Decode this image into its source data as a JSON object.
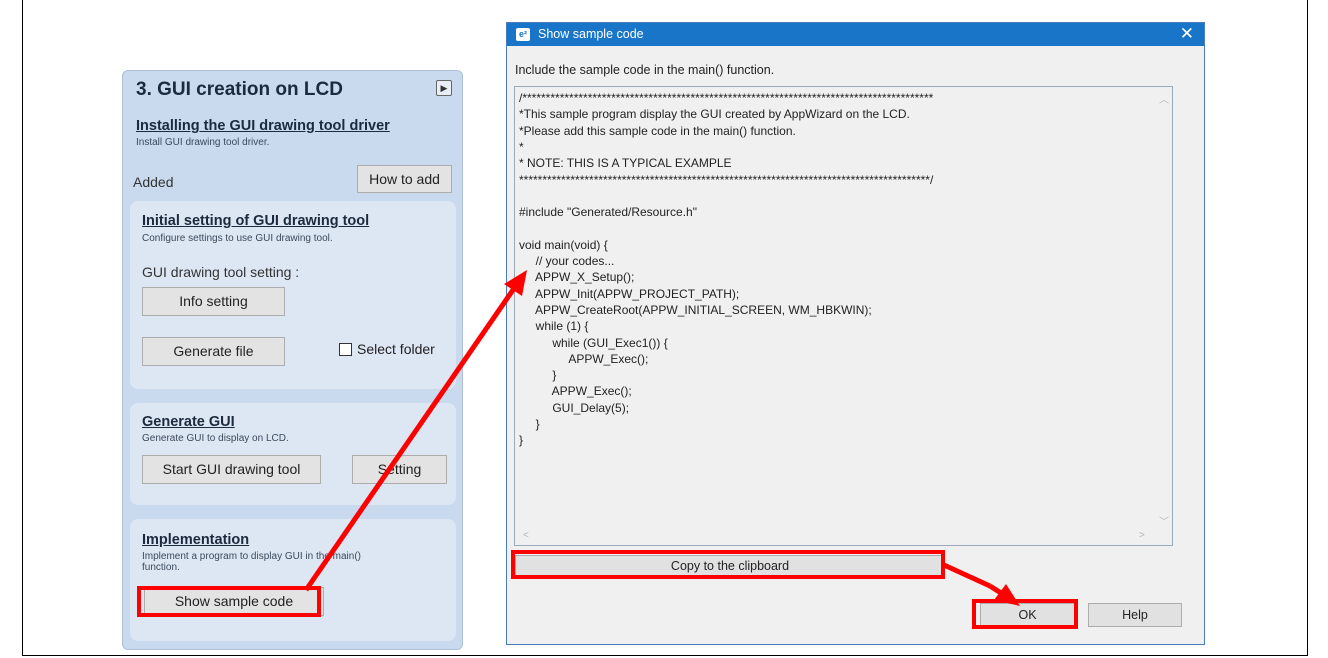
{
  "left_panel": {
    "title": "3. GUI creation on LCD",
    "driver_section": {
      "title": "Installing the GUI drawing tool driver",
      "desc": "Install GUI drawing tool driver.",
      "status": "Added",
      "how_to_add_label": "How to add"
    },
    "initial_section": {
      "title": "Initial setting of GUI drawing tool",
      "desc": "Configure settings to use GUI drawing tool.",
      "setting_label": "GUI drawing tool setting :",
      "info_setting_label": "Info setting",
      "generate_file_label": "Generate file",
      "select_folder_label": "Select folder"
    },
    "generate_section": {
      "title": "Generate GUI",
      "desc": "Generate GUI to display on LCD.",
      "start_tool_label": "Start GUI drawing tool",
      "setting_label": "Setting"
    },
    "implementation_section": {
      "title": "Implementation",
      "desc_line1": "Implement a program to display GUI in the main()",
      "desc_line2": "function.",
      "show_sample_label": "Show sample code"
    }
  },
  "dialog": {
    "title": "Show sample code",
    "app_icon_text": "e²",
    "instruction": "Include the sample code in the main() function.",
    "code_lines": [
      "/****************************************************************************************",
      "*This sample program display the GUI created by AppWizard on the LCD.",
      "*Please add this sample code in the main() function.",
      "*",
      "* NOTE: THIS IS A TYPICAL EXAMPLE",
      "****************************************************************************************/",
      "",
      "#include \"Generated/Resource.h\"",
      "",
      "void main(void) {",
      "     // your codes...",
      "     APPW_X_Setup();",
      "     APPW_Init(APPW_PROJECT_PATH);",
      "     APPW_CreateRoot(APPW_INITIAL_SCREEN, WM_HBKWIN);",
      "     while (1) {",
      "          while (GUI_Exec1()) {",
      "               APPW_Exec();",
      "          }",
      "          APPW_Exec();",
      "          GUI_Delay(5);",
      "     }",
      "}"
    ],
    "copy_label": "Copy to the clipboard",
    "ok_label": "OK",
    "help_label": "Help"
  },
  "colors": {
    "titlebar": "#1975c8",
    "highlight": "#ff0000",
    "panel": "#c9d9ee",
    "card": "#dde6f3"
  }
}
